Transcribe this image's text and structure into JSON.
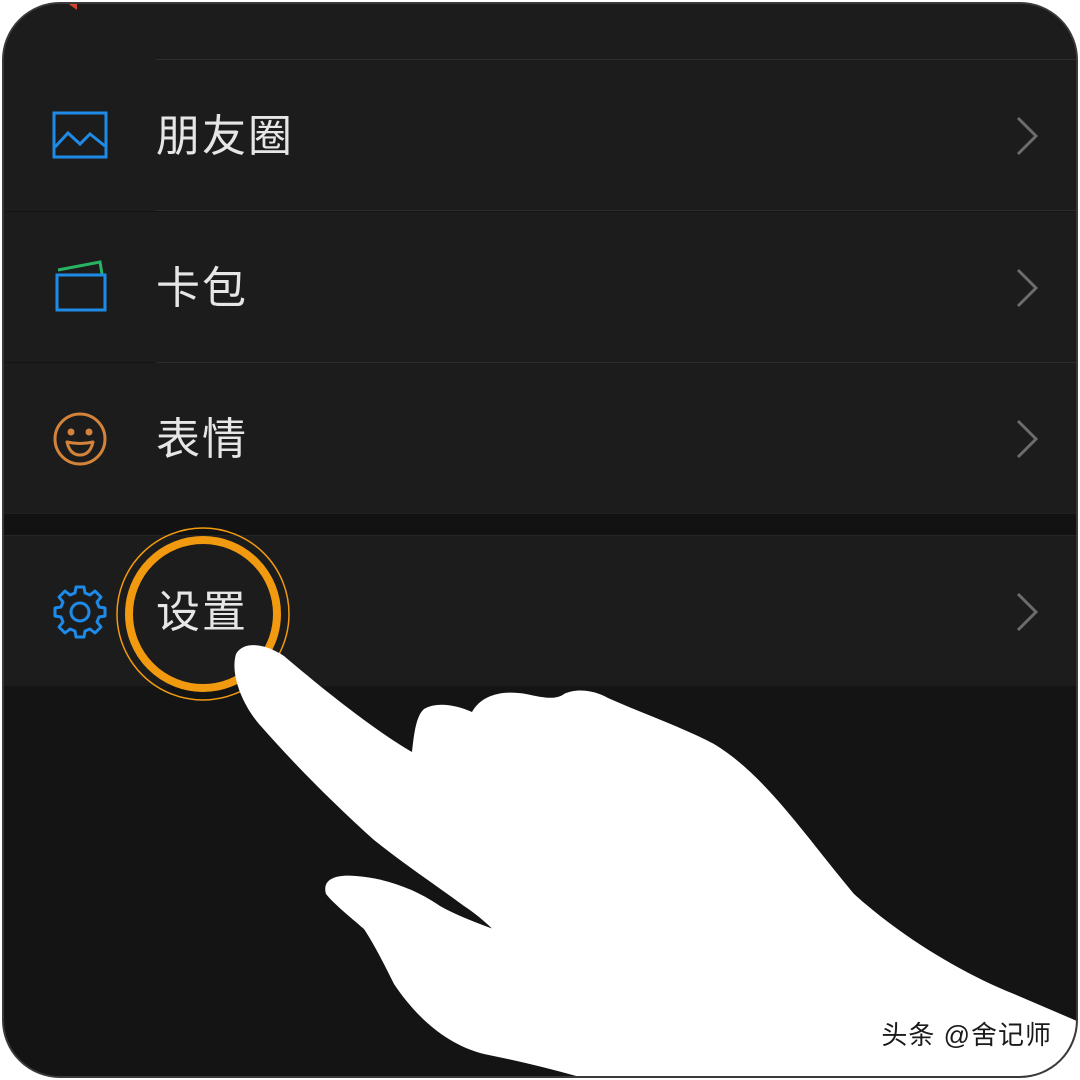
{
  "menu": {
    "items": [
      {
        "label": "朋友圈",
        "icon": "moments-image-icon"
      },
      {
        "label": "卡包",
        "icon": "card-wallet-icon"
      },
      {
        "label": "表情",
        "icon": "smiley-face-icon"
      },
      {
        "label": "设置",
        "icon": "gear-icon"
      }
    ]
  },
  "watermark": "头条 @舍记师",
  "colors": {
    "accent_blue": "#1E8BE8",
    "card_green": "#27B463",
    "smiley_orange": "#D4843A",
    "highlight_orange": "#F29A0F",
    "background": "#1C1C1C"
  }
}
